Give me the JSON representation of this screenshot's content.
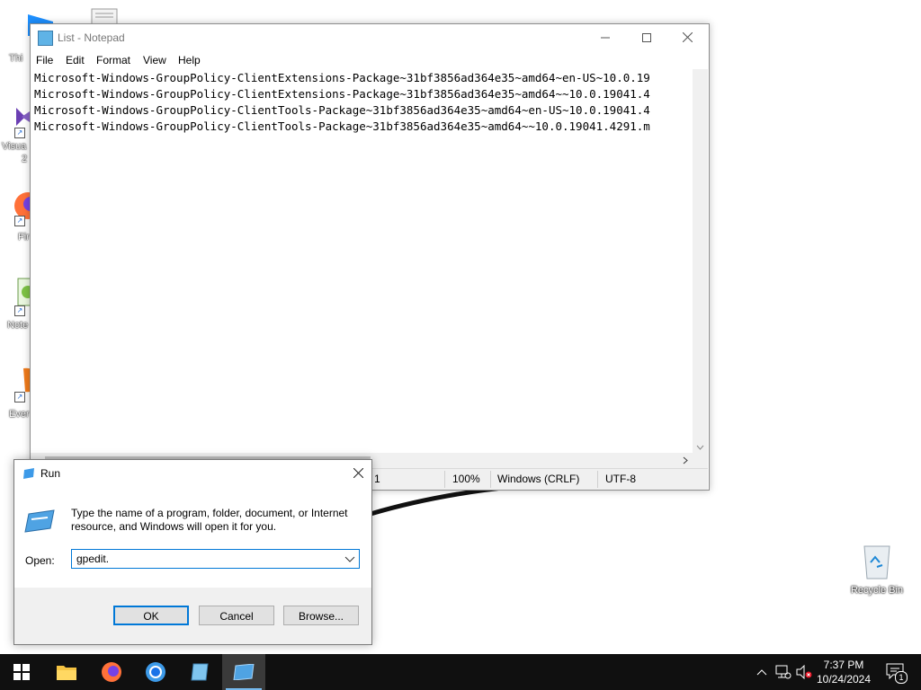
{
  "notepad": {
    "title": "List - Notepad",
    "menu": [
      "File",
      "Edit",
      "Format",
      "View",
      "Help"
    ],
    "lines": [
      "Microsoft-Windows-GroupPolicy-ClientExtensions-Package~31bf3856ad364e35~amd64~en-US~10.0.19",
      "Microsoft-Windows-GroupPolicy-ClientExtensions-Package~31bf3856ad364e35~amd64~~10.0.19041.4",
      "Microsoft-Windows-GroupPolicy-ClientTools-Package~31bf3856ad364e35~amd64~en-US~10.0.19041.4",
      "Microsoft-Windows-GroupPolicy-ClientTools-Package~31bf3856ad364e35~amd64~~10.0.19041.4291.m"
    ],
    "status": {
      "position": "1",
      "zoom": "100%",
      "line_ending": "Windows (CRLF)",
      "encoding": "UTF-8"
    }
  },
  "run": {
    "title": "Run",
    "description": "Type the name of a program, folder, document, or Internet resource, and Windows will open it for you.",
    "open_label": "Open:",
    "input_value": "gpedit.",
    "ok": "OK",
    "cancel": "Cancel",
    "browse": "Browse..."
  },
  "desktop": {
    "icons": [
      "Thi",
      "Visua",
      "2",
      "Fir",
      "Note",
      "Ever"
    ],
    "recycle_bin": "Recycle Bin"
  },
  "taskbar": {
    "time": "7:37 PM",
    "date": "10/24/2024",
    "notification_count": "1"
  },
  "colors": {
    "accent": "#0078d7",
    "taskbar": "#101010"
  }
}
